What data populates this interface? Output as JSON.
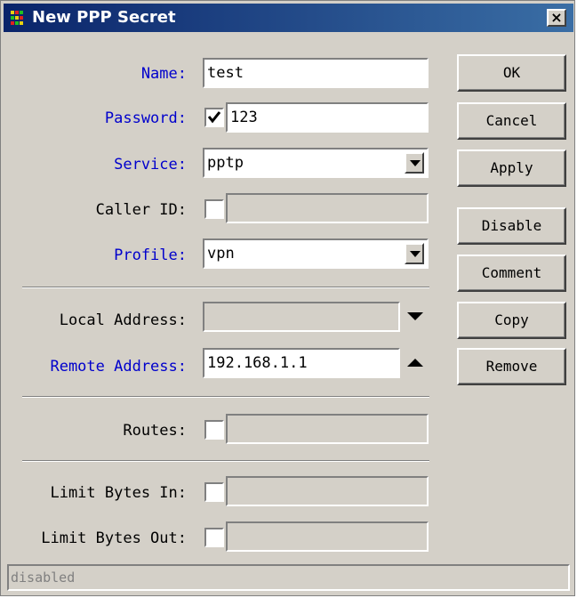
{
  "window": {
    "title": "New PPP Secret",
    "icon": "mikrotik-logo-icon",
    "close_label": "×"
  },
  "form": {
    "name": {
      "label": "Name:",
      "value": "test"
    },
    "password": {
      "label": "Password:",
      "checked": true,
      "value": "123"
    },
    "service": {
      "label": "Service:",
      "value": "pptp"
    },
    "caller_id": {
      "label": "Caller ID:",
      "checked": false,
      "value": ""
    },
    "profile": {
      "label": "Profile:",
      "value": "vpn"
    },
    "local_address": {
      "label": "Local Address:",
      "value": ""
    },
    "remote_address": {
      "label": "Remote Address:",
      "value": "192.168.1.1"
    },
    "routes": {
      "label": "Routes:",
      "checked": false,
      "value": ""
    },
    "limit_bytes_in": {
      "label": "Limit Bytes In:",
      "checked": false,
      "value": ""
    },
    "limit_bytes_out": {
      "label": "Limit Bytes Out:",
      "checked": false,
      "value": ""
    }
  },
  "buttons": {
    "ok": "OK",
    "cancel": "Cancel",
    "apply": "Apply",
    "disable": "Disable",
    "comment": "Comment",
    "copy": "Copy",
    "remove": "Remove"
  },
  "status": {
    "text": "disabled"
  },
  "colors": {
    "title_gradient_start": "#0a246a",
    "title_gradient_end": "#3a6ea5",
    "label_blue": "#0000cc",
    "face": "#d4d0c8"
  }
}
